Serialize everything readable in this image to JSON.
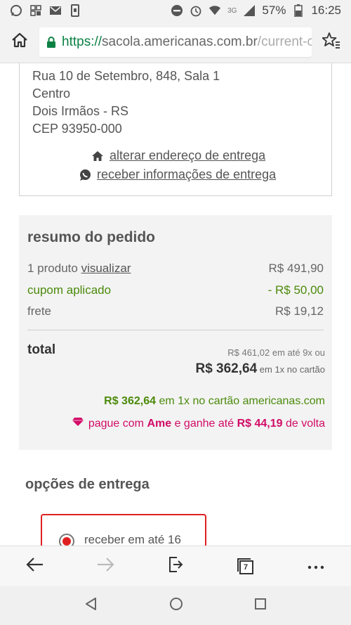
{
  "status_bar": {
    "network": "3G",
    "battery": "57%",
    "time": "16:25"
  },
  "browser": {
    "url_scheme": "https://",
    "url_host": "sacola.americanas.com.br",
    "url_path": "/current-c",
    "tab_count": "7"
  },
  "address": {
    "lines": [
      "Rua 10 de Setembro, 848, Sala 1",
      "Centro",
      "Dois Irmãos - RS",
      "CEP 93950-000"
    ],
    "change_link": "alterar endereço de entrega",
    "whatsapp_link": "receber informações de entrega"
  },
  "summary": {
    "title": "resumo do pedido",
    "products_label": "1 produto",
    "view_link": "visualizar",
    "products_value": "R$ 491,90",
    "coupon_label": "cupom aplicado",
    "coupon_value": "- R$ 50,00",
    "shipping_label": "frete",
    "shipping_value": "R$ 19,12",
    "total_label": "total",
    "installments": "R$ 461,02 em até 9x ou",
    "total_value": "R$ 362,64",
    "total_suffix": "em 1x no cartão",
    "card_value": "R$ 362,64",
    "card_suffix": "em 1x no cartão americanas.com",
    "ame_prefix": "pague com",
    "ame_brand": "Ame",
    "ame_middle": "e ganhe até",
    "ame_cashback": "R$ 44,19",
    "ame_suffix": "de volta"
  },
  "delivery": {
    "title": "opções de entrega",
    "option_label": "receber em até 16"
  },
  "colors": {
    "green": "#4b8a0b",
    "ame": "#d10c67",
    "selected_border": "#e02020"
  }
}
